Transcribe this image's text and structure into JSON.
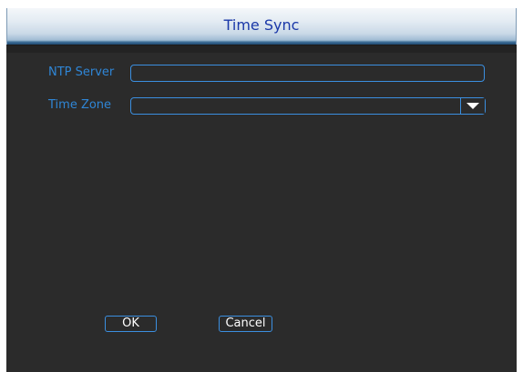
{
  "dialog": {
    "title": "Time Sync"
  },
  "form": {
    "ntp_server": {
      "label": "NTP Server",
      "value": ""
    },
    "time_zone": {
      "label": "Time Zone",
      "selected": "",
      "dropdown_icon": "triangle-down-icon"
    }
  },
  "buttons": {
    "ok_label": "OK",
    "cancel_label": "Cancel"
  },
  "colors": {
    "accent": "#3b8fe0",
    "label_text": "#2f86d6",
    "title_text": "#1a38a8",
    "background": "#2b2b2b"
  }
}
